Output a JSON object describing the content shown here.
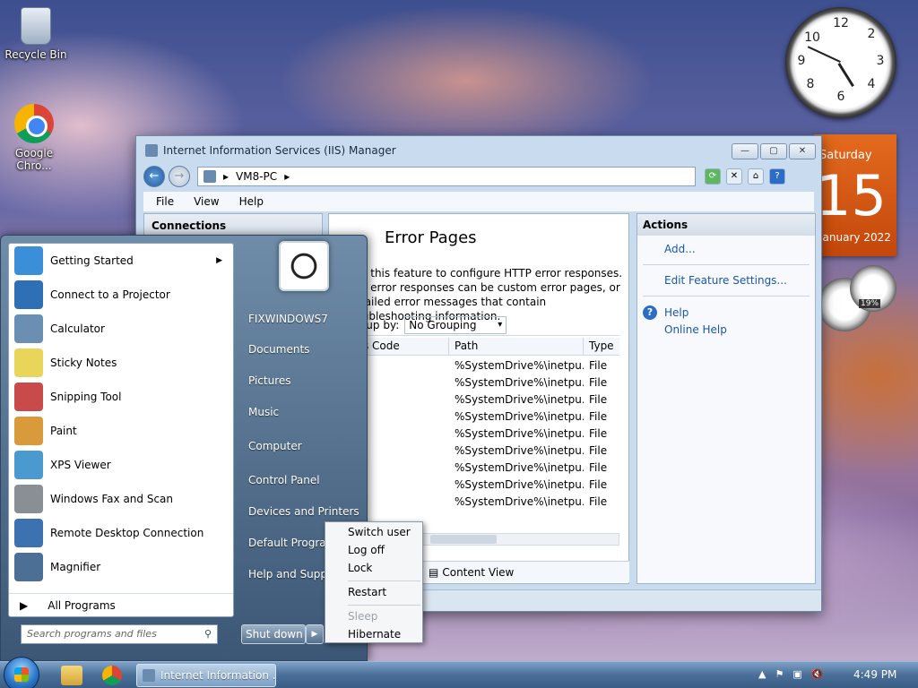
{
  "desktop": {
    "icons": [
      {
        "label": "Recycle Bin"
      },
      {
        "label": "Google Chro..."
      }
    ]
  },
  "gadgets": {
    "calendar": {
      "day": "Saturday",
      "date": "15",
      "month": "January 2022"
    },
    "meter": {
      "percent": "19%"
    }
  },
  "iis": {
    "title": "Internet Information Services (IIS) Manager",
    "address": [
      "VM8-PC"
    ],
    "menu": [
      "File",
      "View",
      "Help"
    ],
    "connections_title": "Connections",
    "page_title": "Error Pages",
    "description": "Use this feature to configure HTTP error responses. The error responses can be custom error pages, or detailed error messages that contain troubleshooting information.",
    "group_label": "Group by:",
    "group_value": "No Grouping",
    "columns": [
      "Status Code",
      "Path",
      "Type"
    ],
    "rows": [
      {
        "path": "%SystemDrive%\\inetpu...",
        "type": "File"
      },
      {
        "path": "%SystemDrive%\\inetpu...",
        "type": "File"
      },
      {
        "path": "%SystemDrive%\\inetpu...",
        "type": "File"
      },
      {
        "path": "%SystemDrive%\\inetpu...",
        "type": "File"
      },
      {
        "path": "%SystemDrive%\\inetpu...",
        "type": "File"
      },
      {
        "path": "%SystemDrive%\\inetpu...",
        "type": "File"
      },
      {
        "path": "%SystemDrive%\\inetpu...",
        "type": "File"
      },
      {
        "path": "%SystemDrive%\\inetpu...",
        "type": "File"
      },
      {
        "path": "%SystemDrive%\\inetpu...",
        "type": "File"
      }
    ],
    "view_tab": "Content View",
    "actions": {
      "title": "Actions",
      "add": "Add...",
      "edit": "Edit Feature Settings...",
      "help": "Help",
      "online_help": "Online Help"
    }
  },
  "startmenu": {
    "programs": [
      {
        "label": "Getting Started",
        "icon": "getting-started-icon",
        "color": "#3a8fd8",
        "submenu": true
      },
      {
        "label": "Connect to a Projector",
        "icon": "projector-icon",
        "color": "#2f6fb6"
      },
      {
        "label": "Calculator",
        "icon": "calculator-icon",
        "color": "#6b8fb2"
      },
      {
        "label": "Sticky Notes",
        "icon": "sticky-notes-icon",
        "color": "#e8d55a"
      },
      {
        "label": "Snipping Tool",
        "icon": "scissors-icon",
        "color": "#c94a4a"
      },
      {
        "label": "Paint",
        "icon": "paint-icon",
        "color": "#d89a3a"
      },
      {
        "label": "XPS Viewer",
        "icon": "xps-viewer-icon",
        "color": "#4a9ad0"
      },
      {
        "label": "Windows Fax and Scan",
        "icon": "fax-icon",
        "color": "#8a8f96"
      },
      {
        "label": "Remote Desktop Connection",
        "icon": "remote-desktop-icon",
        "color": "#3d72b0"
      },
      {
        "label": "Magnifier",
        "icon": "magnifier-icon",
        "color": "#4b6f95"
      }
    ],
    "all_programs": "All Programs",
    "search_placeholder": "Search programs and files",
    "user": "FIXWINDOWS7",
    "right_items": [
      "Documents",
      "Pictures",
      "Music",
      "Computer",
      "Control Panel",
      "Devices and Printers",
      "Default Programs",
      "Help and Support"
    ],
    "shutdown": "Shut down"
  },
  "power_menu": {
    "items": [
      "Switch user",
      "Log off",
      "Lock",
      "Restart",
      "Sleep",
      "Hibernate"
    ]
  },
  "taskbar": {
    "task": "Internet Information ...",
    "time": "4:49 PM"
  }
}
